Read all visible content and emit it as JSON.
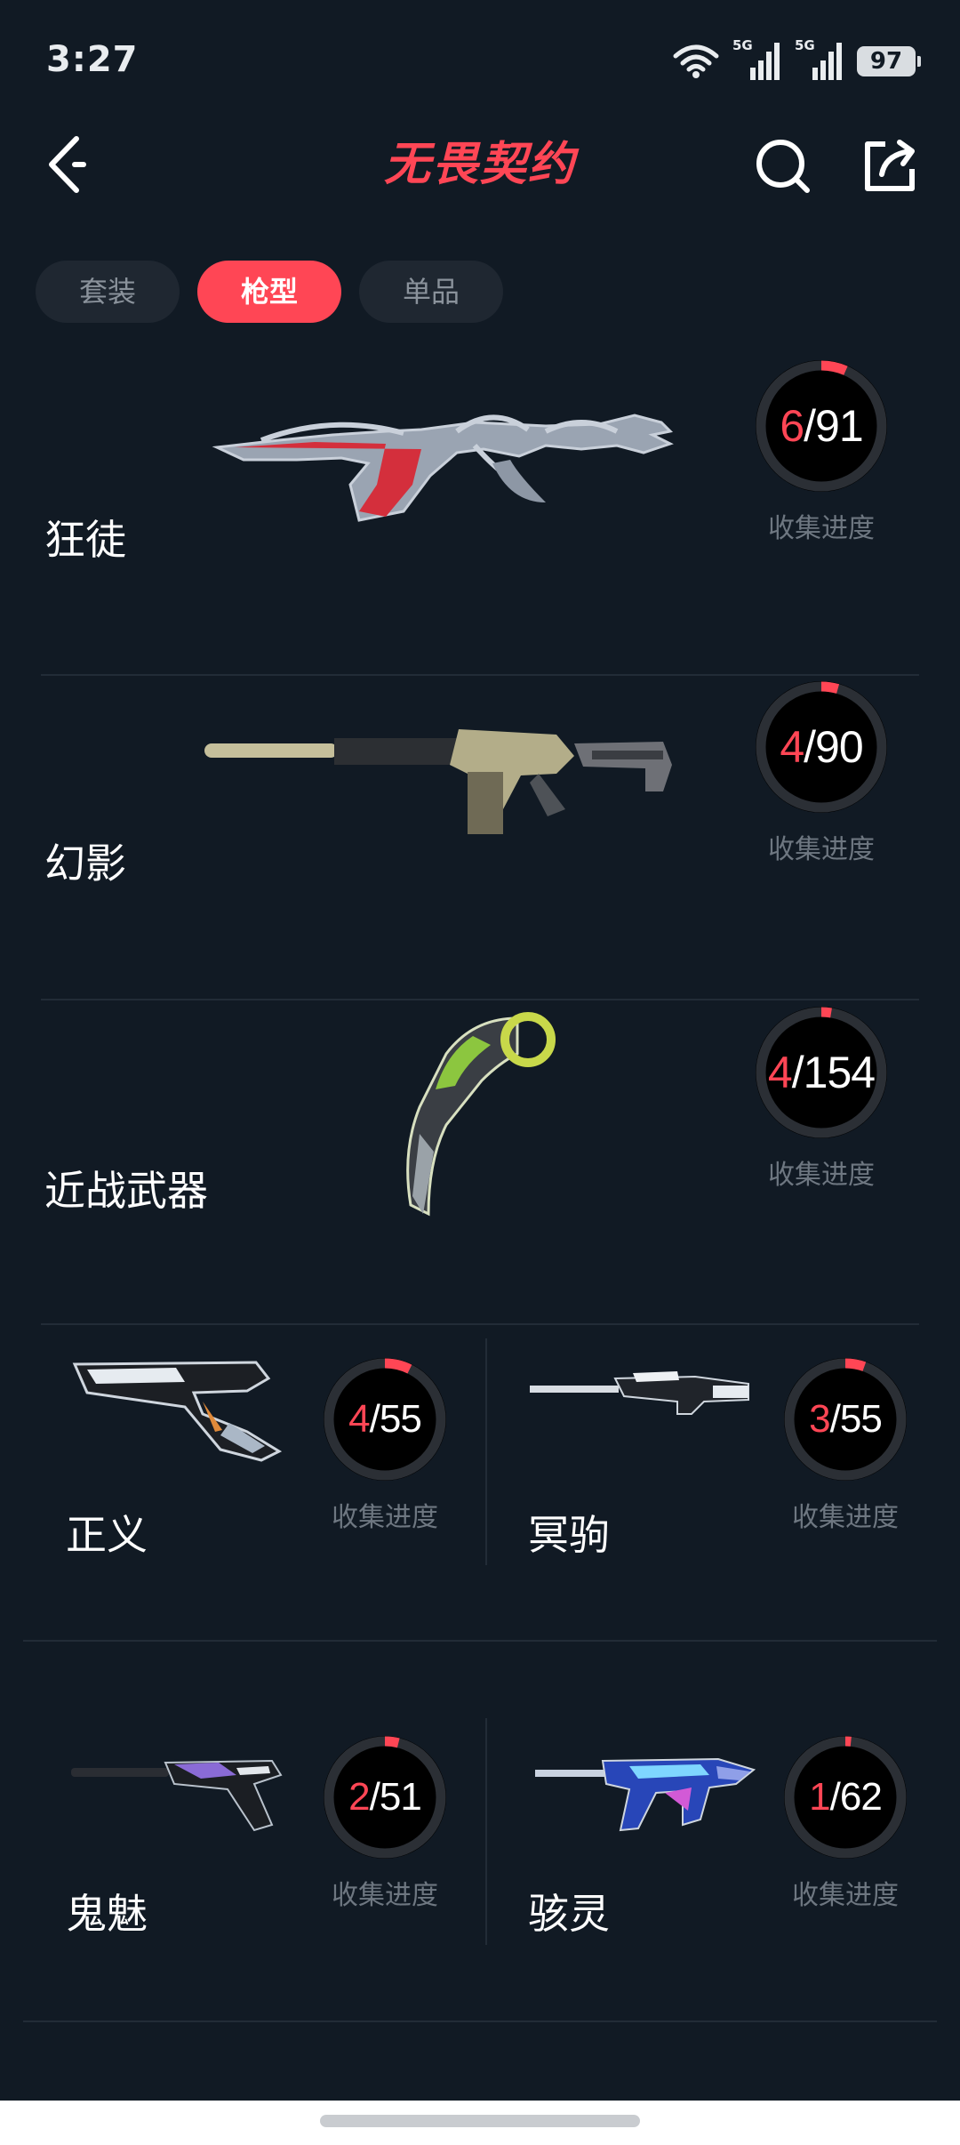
{
  "status_bar": {
    "time": "3:27",
    "signal1": "5G",
    "signal2": "5G",
    "battery": "97"
  },
  "header": {
    "title": "无畏契约"
  },
  "tabs": [
    {
      "label": "套装",
      "active": false
    },
    {
      "label": "枪型",
      "active": true
    },
    {
      "label": "单品",
      "active": false
    }
  ],
  "weapons": [
    {
      "name": "狂徒",
      "have": "6",
      "total": "91",
      "progress_label": "收集进度",
      "progress": 0.066
    },
    {
      "name": "幻影",
      "have": "4",
      "total": "90",
      "progress_label": "收集进度",
      "progress": 0.044
    },
    {
      "name": "近战武器",
      "have": "4",
      "total": "154",
      "progress_label": "收集进度",
      "progress": 0.026
    },
    {
      "name": "正义",
      "have": "4",
      "total": "55",
      "progress_label": "收集进度",
      "progress": 0.073
    },
    {
      "name": "冥驹",
      "have": "3",
      "total": "55",
      "progress_label": "收集进度",
      "progress": 0.055
    },
    {
      "name": "鬼魅",
      "have": "2",
      "total": "51",
      "progress_label": "收集进度",
      "progress": 0.039
    },
    {
      "name": "骇灵",
      "have": "1",
      "total": "62",
      "progress_label": "收集进度",
      "progress": 0.016
    }
  ],
  "colors": {
    "accent": "#ff4655",
    "background": "#111a24",
    "ring_track": "#2b2f35"
  },
  "icons": {
    "back": "chevron-left-icon",
    "search": "search-icon",
    "share": "share-icon"
  }
}
